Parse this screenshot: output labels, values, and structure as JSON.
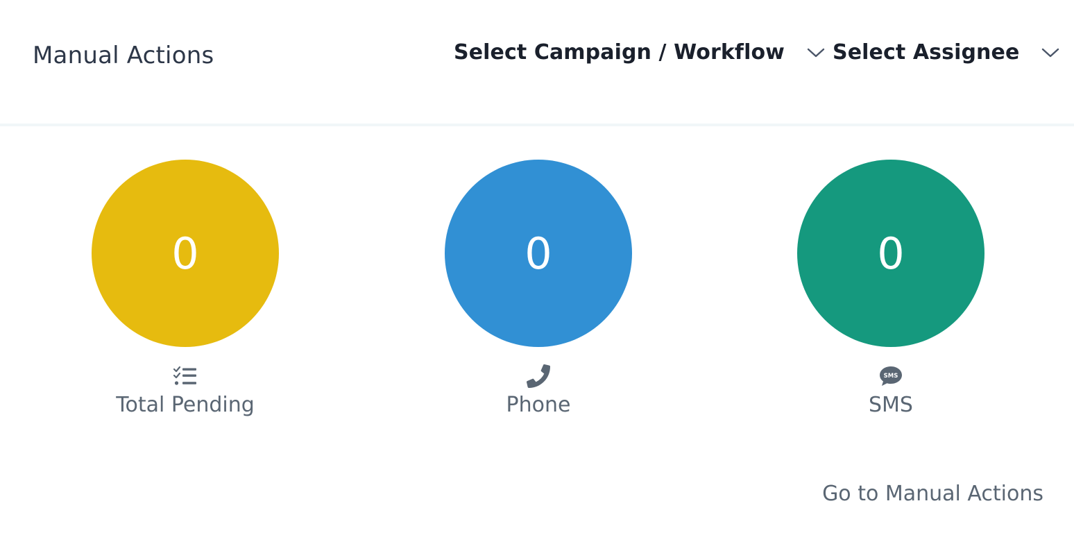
{
  "header": {
    "title": "Manual Actions",
    "campaign_dropdown": {
      "label": "Select Campaign / Workflow",
      "icon": "chevron-down-icon"
    },
    "assignee_dropdown": {
      "label": "Select Assignee",
      "icon": "chevron-down-icon"
    }
  },
  "stats": [
    {
      "id": "total-pending",
      "value": "0",
      "label": "Total Pending",
      "icon": "checklist-icon",
      "color": "#e6bb0f"
    },
    {
      "id": "phone",
      "value": "0",
      "label": "Phone",
      "icon": "phone-icon",
      "color": "#3190d4"
    },
    {
      "id": "sms",
      "value": "0",
      "label": "SMS",
      "icon": "sms-icon",
      "color": "#15997e"
    }
  ],
  "footer": {
    "link_label": "Go to Manual Actions"
  },
  "colors": {
    "text_primary": "#1a202c",
    "text_muted": "#5a6673",
    "divider": "#f1f6f8"
  }
}
